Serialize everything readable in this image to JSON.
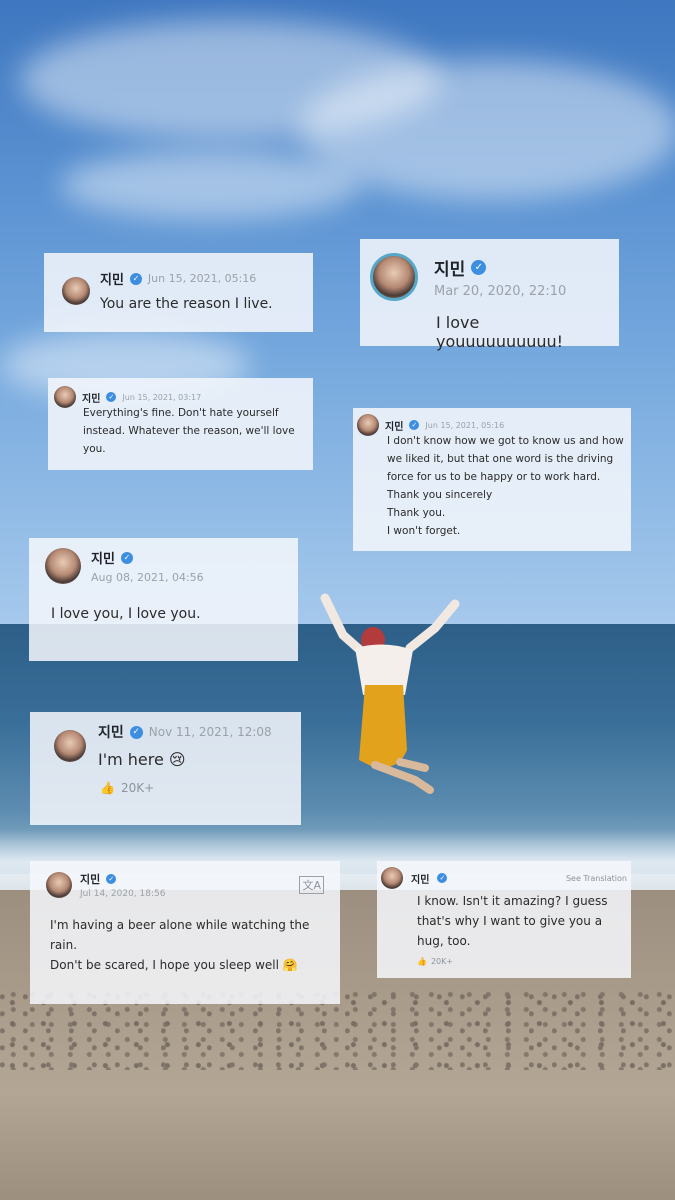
{
  "cards": [
    {
      "name": "지민",
      "date": "Jun 15, 2021, 05:16",
      "text": "You are the reason I live."
    },
    {
      "name": "지민",
      "date": "Mar 20, 2020, 22:10",
      "text": "I love youuuuuuuuuu!"
    },
    {
      "name": "지민",
      "date": "Jun 15, 2021, 03:17",
      "text": "Everything's fine. Don't hate yourself instead. Whatever the reason, we'll love you."
    },
    {
      "name": "지민",
      "date": "Jun 15, 2021, 05:16",
      "text": "I don't know how we got to know us and how we liked it, but that one word is the driving force for us to be happy or to work hard. Thank you sincerely\nThank you.\nI won't forget."
    },
    {
      "name": "지민",
      "date": "Aug 08, 2021, 04:56",
      "text": "I love you, I love you."
    },
    {
      "name": "지민",
      "date": "Nov 11, 2021, 12:08",
      "text": "I'm here 😢",
      "likes": "20K+"
    },
    {
      "name": "지민",
      "date": "Jul 14, 2020, 18:56",
      "text": "I'm having a beer alone while watching the rain.\n Don't be scared, I hope you sleep well 🤗"
    },
    {
      "name": "지민",
      "see_translation": "See Translation",
      "text": "I know. Isn't it amazing? I guess that's why I want to give you a hug, too.",
      "likes": "20K+"
    }
  ],
  "colors": {
    "verified": "#3d8ee0",
    "card_bg": "#f4f7fc",
    "date": "#9aa1a9"
  },
  "icons": {
    "verified": "check-icon",
    "like": "thumbs-up-icon",
    "translate": "translate-icon"
  }
}
